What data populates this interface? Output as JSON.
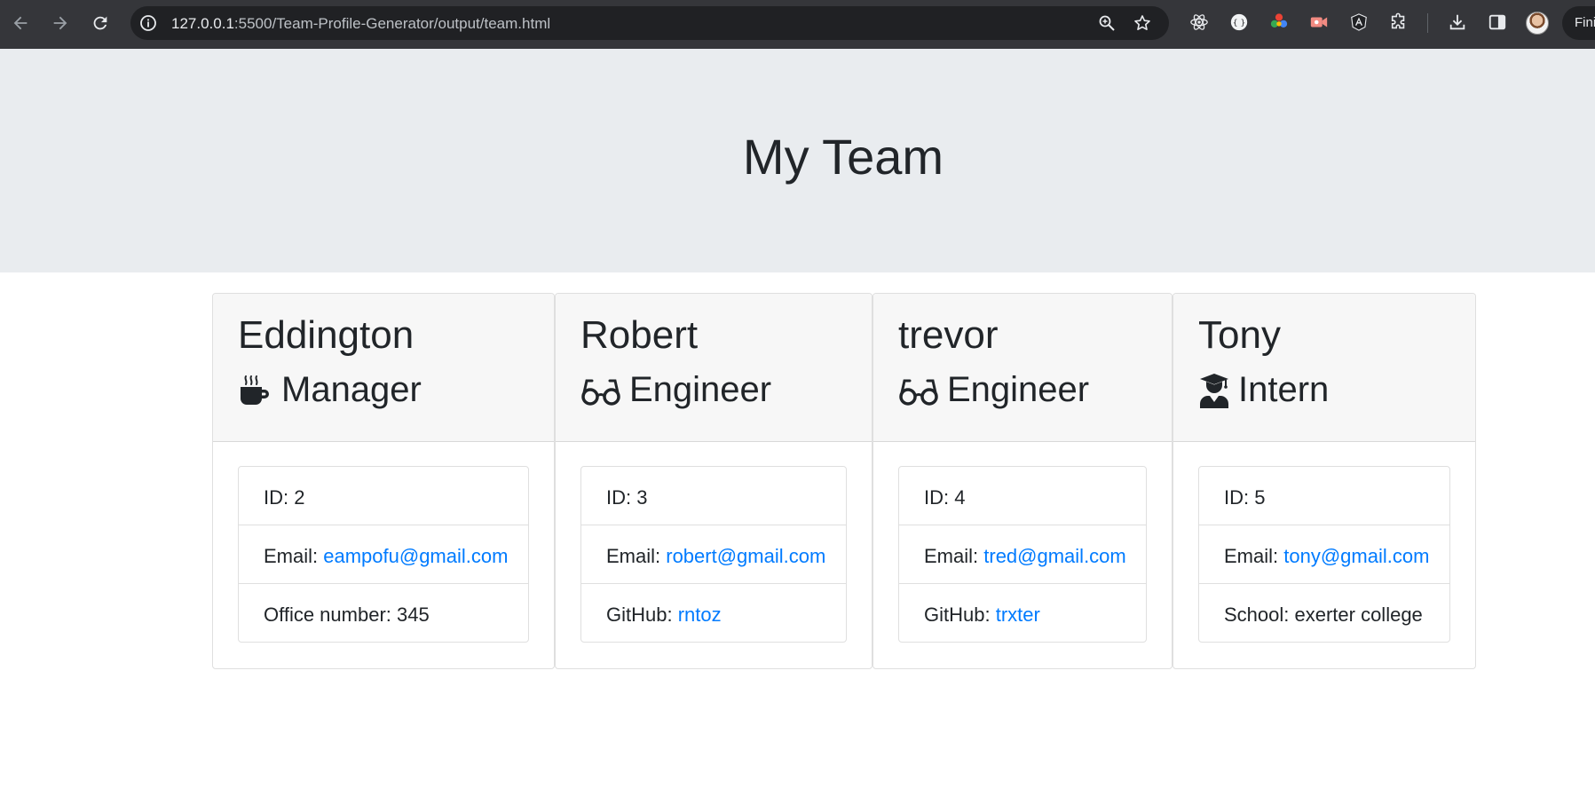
{
  "browser": {
    "url_host": "127.0.0.1",
    "url_rest": ":5500/Team-Profile-Generator/output/team.html",
    "profile_label": "Fini"
  },
  "page": {
    "title": "My Team"
  },
  "team": [
    {
      "name": "Eddington",
      "role": "Manager",
      "role_icon": "mug-icon",
      "id_label": "ID: 2",
      "email_prefix": "Email: ",
      "email": "eampofu@gmail.com",
      "extra_prefix": "Office number: 345",
      "extra_link": ""
    },
    {
      "name": "Robert",
      "role": "Engineer",
      "role_icon": "glasses-icon",
      "id_label": "ID: 3",
      "email_prefix": "Email: ",
      "email": "robert@gmail.com",
      "extra_prefix": "GitHub: ",
      "extra_link": "rntoz"
    },
    {
      "name": "trevor",
      "role": "Engineer",
      "role_icon": "glasses-icon",
      "id_label": "ID: 4",
      "email_prefix": "Email: ",
      "email": "tred@gmail.com",
      "extra_prefix": "GitHub: ",
      "extra_link": "trxter"
    },
    {
      "name": "Tony",
      "role": "Intern",
      "role_icon": "graduate-icon",
      "id_label": "ID: 5",
      "email_prefix": "Email: ",
      "email": "tony@gmail.com",
      "extra_prefix": "School: exerter college",
      "extra_link": ""
    }
  ],
  "colors": {
    "link": "#007bff",
    "jumbotron": "#e9ecef",
    "card_header": "#f7f7f7",
    "chrome": "#35363a"
  }
}
